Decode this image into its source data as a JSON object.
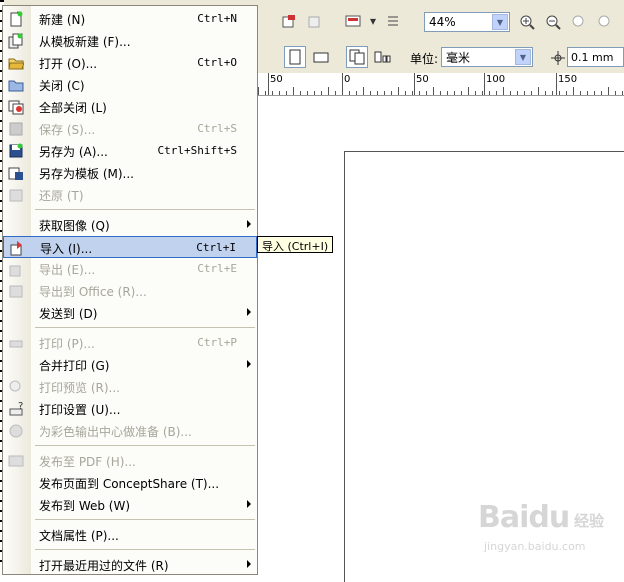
{
  "toolbar": {
    "zoom_value": "44%",
    "units_label": "单位:",
    "units_value": "毫米",
    "nudge_value": "0.1 mm"
  },
  "ruler": {
    "ticks": [
      {
        "label": "50",
        "pos": 268
      },
      {
        "label": "0",
        "pos": 342
      },
      {
        "label": "50",
        "pos": 414
      },
      {
        "label": "100",
        "pos": 484
      },
      {
        "label": "150",
        "pos": 556
      }
    ]
  },
  "menu": {
    "items": [
      {
        "label": "新建 (N)",
        "shortcut": "Ctrl+N",
        "icon": "new-doc-icon",
        "enabled": true
      },
      {
        "label": "从模板新建 (F)...",
        "shortcut": "",
        "icon": "template-new-icon",
        "enabled": true
      },
      {
        "label": "打开 (O)...",
        "shortcut": "Ctrl+O",
        "icon": "open-folder-icon",
        "enabled": true
      },
      {
        "label": "关闭 (C)",
        "shortcut": "",
        "icon": "close-doc-icon",
        "enabled": true
      },
      {
        "label": "全部关闭 (L)",
        "shortcut": "",
        "icon": "close-all-icon",
        "enabled": true
      },
      {
        "label": "保存 (S)...",
        "shortcut": "Ctrl+S",
        "icon": "save-icon",
        "enabled": false
      },
      {
        "label": "另存为 (A)...",
        "shortcut": "Ctrl+Shift+S",
        "icon": "save-as-icon",
        "enabled": true
      },
      {
        "label": "另存为模板 (M)...",
        "shortcut": "",
        "icon": "save-template-icon",
        "enabled": true
      },
      {
        "label": "还原 (T)",
        "shortcut": "",
        "icon": "revert-icon",
        "enabled": false
      },
      {
        "label": "获取图像 (Q)",
        "shortcut": "",
        "icon": "",
        "enabled": true,
        "submenu": true
      },
      {
        "label": "导入 (I)...",
        "shortcut": "Ctrl+I",
        "icon": "import-icon",
        "enabled": true,
        "highlight": true
      },
      {
        "label": "导出 (E)...",
        "shortcut": "Ctrl+E",
        "icon": "export-icon",
        "enabled": false
      },
      {
        "label": "导出到 Office (R)...",
        "shortcut": "",
        "icon": "export-office-icon",
        "enabled": false
      },
      {
        "label": "发送到 (D)",
        "shortcut": "",
        "icon": "",
        "enabled": true,
        "submenu": true
      },
      {
        "label": "打印 (P)...",
        "shortcut": "Ctrl+P",
        "icon": "print-icon",
        "enabled": false
      },
      {
        "label": "合并打印 (G)",
        "shortcut": "",
        "icon": "",
        "enabled": true,
        "submenu": true
      },
      {
        "label": "打印预览 (R)...",
        "shortcut": "",
        "icon": "print-preview-icon",
        "enabled": false
      },
      {
        "label": "打印设置 (U)...",
        "shortcut": "",
        "icon": "print-setup-icon",
        "enabled": true
      },
      {
        "label": "为彩色输出中心做准备 (B)...",
        "shortcut": "",
        "icon": "prepare-service-icon",
        "enabled": false
      },
      {
        "label": "发布至 PDF (H)...",
        "shortcut": "",
        "icon": "pdf-icon",
        "enabled": false
      },
      {
        "label": "发布页面到 ConceptShare (T)...",
        "shortcut": "",
        "icon": "",
        "enabled": true
      },
      {
        "label": "发布到 Web (W)",
        "shortcut": "",
        "icon": "",
        "enabled": true,
        "submenu": true
      },
      {
        "label": "文档属性 (P)...",
        "shortcut": "",
        "icon": "",
        "enabled": true
      },
      {
        "label": "打开最近用过的文件 (R)",
        "shortcut": "",
        "icon": "",
        "enabled": true,
        "submenu": true
      }
    ]
  },
  "tooltip": "导入 (Ctrl+I)",
  "watermark": {
    "main": "Baidu",
    "cn": "经验",
    "sub": "jingyan.baidu.com"
  }
}
